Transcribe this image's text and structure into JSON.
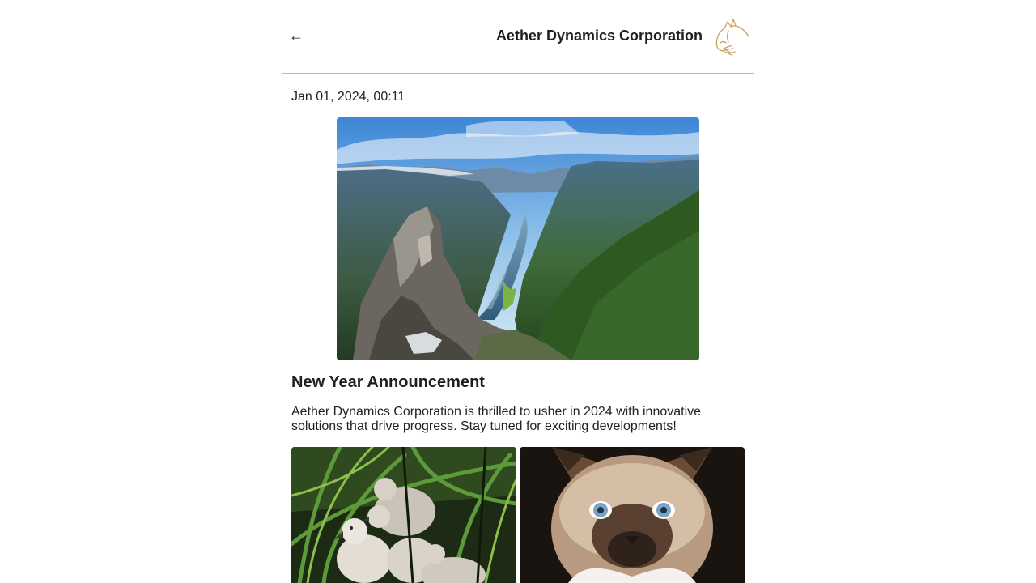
{
  "header": {
    "back_icon": "left-arrow-icon",
    "back_glyph": "←",
    "title": "Aether Dynamics Corporation",
    "logo_icon": "cat-line-logo",
    "logo_color": "#c9a45c"
  },
  "post": {
    "timestamp": "Jan 01, 2024, 00:11",
    "hero_image": "fjord-landscape-photo",
    "title": "New Year Announcement",
    "body": "Aether Dynamics Corporation is thrilled to usher in 2024 with innovative solutions that drive progress. Stay tuned for exciting developments!",
    "gallery": [
      {
        "image": "cygnets-in-grass-photo"
      },
      {
        "image": "siamese-kitten-photo"
      }
    ]
  }
}
